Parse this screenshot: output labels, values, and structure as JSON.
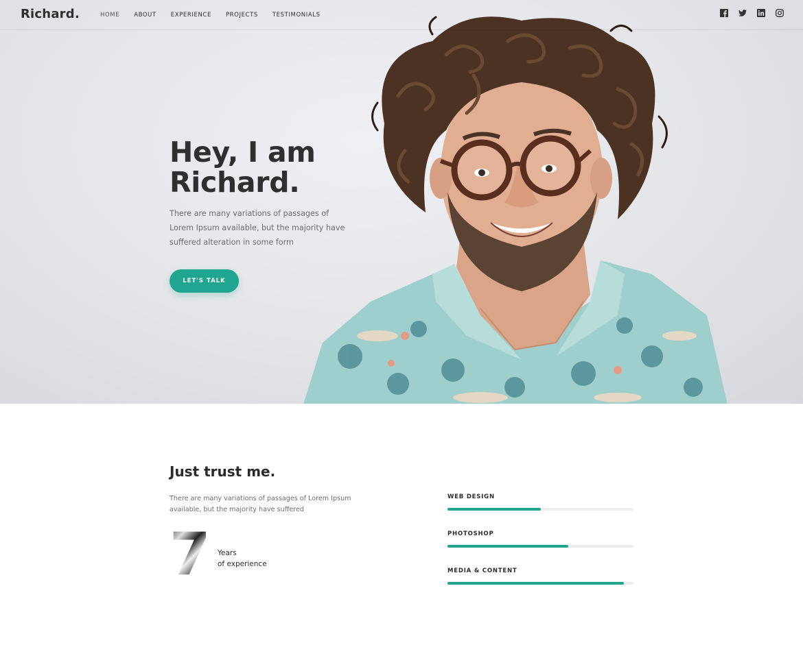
{
  "brand": {
    "logo": "Richard."
  },
  "nav": {
    "items": [
      {
        "label": "HOME",
        "active": true
      },
      {
        "label": "ABOUT"
      },
      {
        "label": "EXPERIENCE"
      },
      {
        "label": "PROJECTS"
      },
      {
        "label": "TESTIMONIALS"
      }
    ]
  },
  "social": {
    "icons": [
      "facebook-icon",
      "twitter-icon",
      "linkedin-icon",
      "instagram-icon"
    ]
  },
  "hero": {
    "title_line1": "Hey, I am",
    "title_line2": "Richard.",
    "description": "There are many variations of passages of Lorem Ipsum available, but the majority have suffered alteration in some form",
    "cta_label": "LET'S TALK"
  },
  "about": {
    "title": "Just trust me.",
    "description": "There are many variations of passages of Lorem Ipsum available, but the majority have suffered",
    "years_number": "7",
    "years_label1": "Years",
    "years_label2": "of experience"
  },
  "skills": [
    {
      "name": "WEB DESIGN",
      "percent": 50
    },
    {
      "name": "PHOTOSHOP",
      "percent": 65
    },
    {
      "name": "MEDIA & CONTENT",
      "percent": 95
    }
  ],
  "colors": {
    "accent": "#1fa590",
    "text": "#2b2b2b",
    "muted": "#6d6d6d"
  }
}
